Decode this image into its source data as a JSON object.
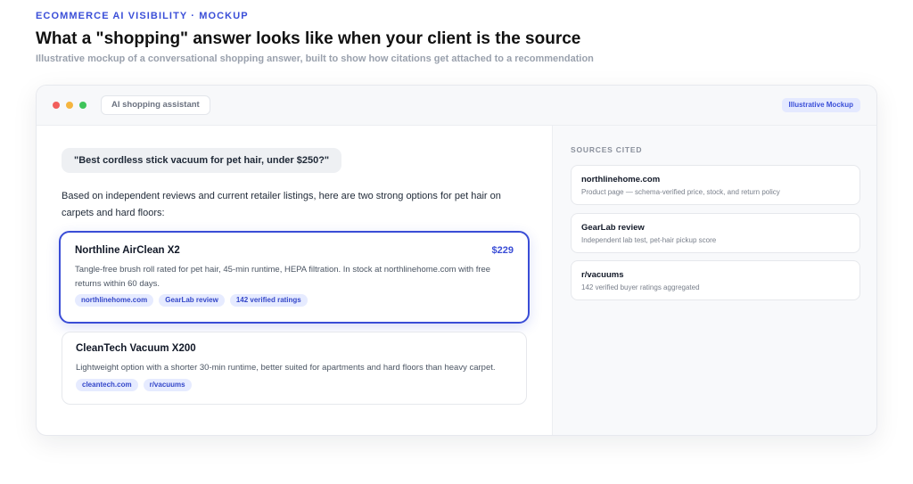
{
  "header": {
    "eyebrow": "ECOMMERCE AI VISIBILITY · MOCKUP",
    "title": "What a \"shopping\" answer looks like when your client is the source",
    "subtitle": "Illustrative mockup of a conversational shopping answer, built to show how citations get attached to a recommendation"
  },
  "window": {
    "tab_label": "AI shopping assistant",
    "badge": "Illustrative Mockup"
  },
  "chat": {
    "query": "\"Best cordless stick vacuum for pet hair, under $250?\"",
    "intro": "Based on independent reviews and current retailer listings, here are two strong options for pet hair on carpets and hard floors:",
    "products": [
      {
        "name": "Northline AirClean X2",
        "price": "$229",
        "description": "Tangle-free brush roll rated for pet hair, 45-min runtime, HEPA filtration. In stock at northlinehome.com with free returns within 60 days.",
        "tags": [
          "northlinehome.com",
          "GearLab review",
          "142 verified ratings"
        ]
      },
      {
        "name": "CleanTech Vacuum X200",
        "description": "Lightweight option with a shorter 30-min runtime, better suited for apartments and hard floors than heavy carpet.",
        "tags": [
          "cleantech.com",
          "r/vacuums"
        ]
      }
    ]
  },
  "sources": {
    "title": "SOURCES CITED",
    "items": [
      {
        "name": "northlinehome.com",
        "description": "Product page — schema-verified price, stock, and return policy"
      },
      {
        "name": "GearLab review",
        "description": "Independent lab test, pet-hair pickup score"
      },
      {
        "name": "r/vacuums",
        "description": "142 verified buyer ratings aggregated"
      }
    ]
  },
  "colors": {
    "accent": "#3a4dd6",
    "tag_bg": "#e6ebff",
    "window_dot_red": "#f25f5c",
    "window_dot_yellow": "#f5b53f",
    "window_dot_green": "#3fc45a"
  }
}
